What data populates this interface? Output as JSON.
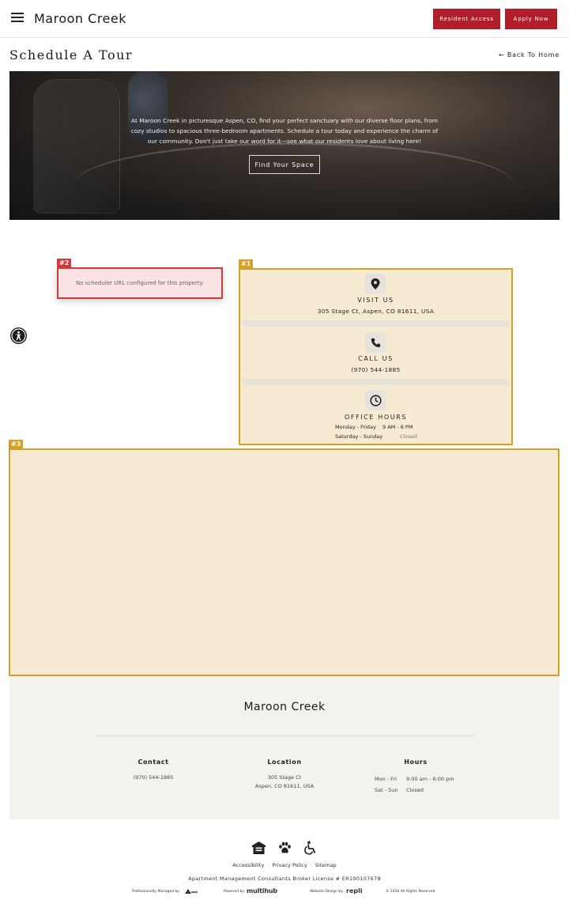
{
  "header": {
    "brand": "Maroon Creek",
    "resident_access": "Resident Access",
    "apply_now": "Apply Now"
  },
  "page": {
    "title": "Schedule A Tour",
    "back_link": "← Back To Home"
  },
  "hero": {
    "text": "At Maroon Creek in picturesque Aspen, CO, find your perfect sanctuary with our diverse floor plans, from cozy studios to spacious three-bedroom apartments. Schedule a tour today and experience the charm of our community. Don't just take our word for it—see what our residents love about living here!",
    "button": "Find Your Space"
  },
  "tags": {
    "one": "#1",
    "two": "#2",
    "three": "#3"
  },
  "scheduler": {
    "message": "No scheduler URL configured for this property."
  },
  "contact": {
    "visit_label": "VISIT US",
    "visit_value": "305 Stage Ct, Aspen, CO 81611, USA",
    "call_label": "CALL US",
    "call_value": "(970) 544-1885",
    "hours_label": "OFFICE HOURS",
    "hours": [
      {
        "days": "Monday - Friday",
        "time": "9 AM - 6 PM"
      },
      {
        "days": "Saturday - Sunday",
        "time": "Closed"
      }
    ]
  },
  "footer": {
    "brand": "Maroon Creek",
    "contact_heading": "Contact",
    "contact_phone": "(970) 544-1885",
    "location_heading": "Location",
    "location_line1": "305 Stage Ct",
    "location_line2": "Aspen, CO 81611, USA",
    "hours_heading": "Hours",
    "hours": [
      {
        "days": "Mon - Fri",
        "time": "9:00 am - 6:00 pm"
      },
      {
        "days": "Sat - Sun",
        "time": "Closed"
      }
    ]
  },
  "bottom": {
    "accessibility": "Accessibility",
    "privacy": "Privacy Policy",
    "sitemap": "Sitemap",
    "broker": "Apartment Management Consultants  Broker License # ER100107678",
    "managed_by": "Professionally Managed by",
    "powered_by": "Powered by",
    "multihub": "multihub",
    "design_by": "Website Design by",
    "repli": "repli",
    "copyright": "© 2026 All Rights Reserved"
  },
  "icons": {
    "menu": "hamburger-menu-icon",
    "location": "map-pin-icon",
    "phone": "phone-icon",
    "clock": "clock-icon",
    "accessibility": "accessibility-icon",
    "equal_housing": "equal-housing-icon",
    "pet": "paw-icon",
    "wheelchair": "wheelchair-icon"
  },
  "colors": {
    "brand_red": "#b01e2b",
    "annotation_red": "#d33a3a",
    "annotation_gold": "#d4a125",
    "highlight_fill": "#f7ead3"
  }
}
